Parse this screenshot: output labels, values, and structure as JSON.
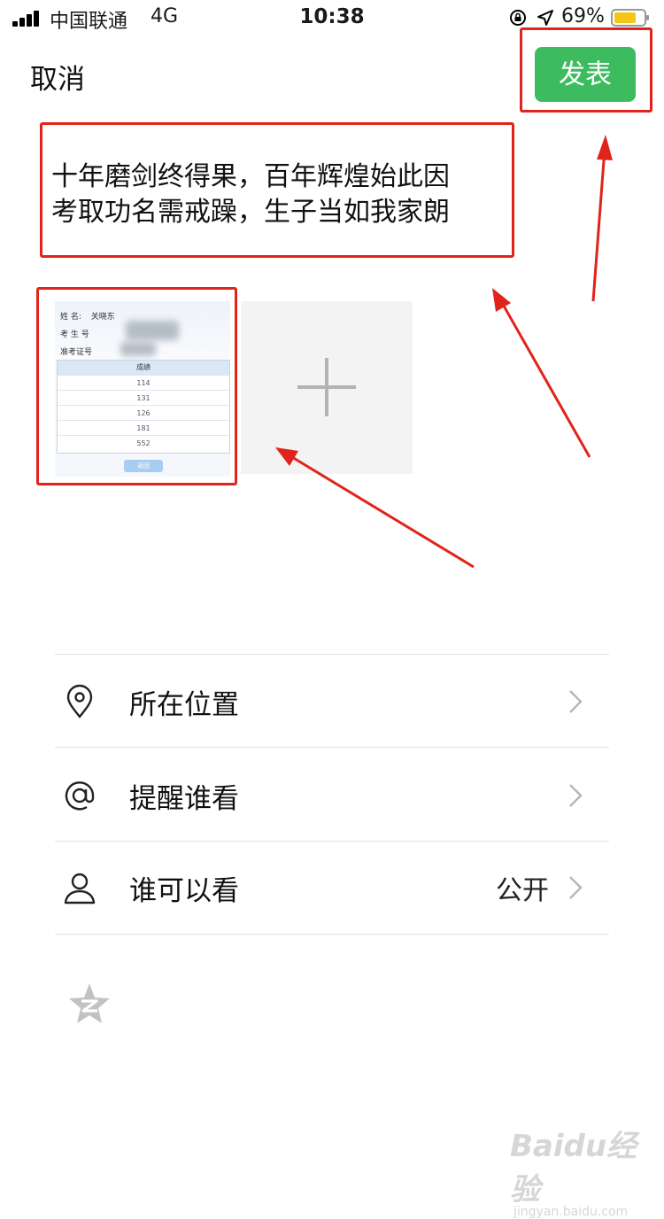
{
  "status_bar": {
    "carrier": "中国联通",
    "network": "4G",
    "time": "10:38",
    "battery_percent": "69%",
    "battery_color": "#f5c518"
  },
  "header": {
    "cancel_label": "取消",
    "publish_label": "发表",
    "publish_color": "#3dbb5f"
  },
  "post": {
    "text": "十年磨剑终得果，百年辉煌始此因\n考取功名需戒躁，生子当如我家朗"
  },
  "thumbnail": {
    "name_label": "姓    名:",
    "name_value": "关晓东",
    "exam_no_label": "考 生 号",
    "ticket_label": "准考证号",
    "score_header": "成绩",
    "scores": [
      "114",
      "131",
      "126",
      "181",
      "552"
    ],
    "button_label": "返回"
  },
  "add_photo_icon": "plus-icon",
  "options": [
    {
      "icon": "location-pin-icon",
      "label": "所在位置",
      "value": ""
    },
    {
      "icon": "at-sign-icon",
      "label": "提醒谁看",
      "value": ""
    },
    {
      "icon": "person-icon",
      "label": "谁可以看",
      "value": "公开"
    }
  ],
  "qzone_icon": "qzone-star-icon",
  "annotation_color": "#e0241b",
  "watermark": {
    "logo": "Baidu经验",
    "site": "jingyan.baidu.com"
  }
}
